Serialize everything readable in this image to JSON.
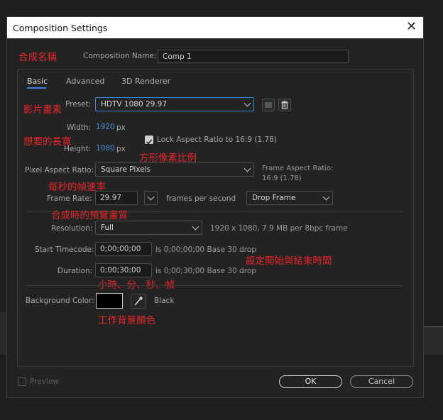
{
  "dialog": {
    "title": "Composition Settings",
    "close_glyph": "✕"
  },
  "comp_name": {
    "label": "Composition Name:",
    "value": "Comp 1"
  },
  "tabs": [
    {
      "label": "Basic"
    },
    {
      "label": "Advanced"
    },
    {
      "label": "3D Renderer"
    }
  ],
  "preset": {
    "label": "Preset:",
    "value": "HDTV 1080 29.97"
  },
  "width": {
    "label": "Width:",
    "value": "1920",
    "unit": "px"
  },
  "height": {
    "label": "Height:",
    "value": "1080",
    "unit": "px"
  },
  "lock_aspect": {
    "label": "Lock Aspect Ratio to 16:9 (1.78)",
    "checked": true
  },
  "pixel_aspect": {
    "label": "Pixel Aspect Ratio:",
    "value": "Square Pixels"
  },
  "frame_aspect": {
    "label": "Frame Aspect Ratio:",
    "value": "16:9 (1.78)"
  },
  "frame_rate": {
    "label": "Frame Rate:",
    "value": "29.97",
    "unit": "frames per second",
    "drop": "Drop Frame"
  },
  "resolution": {
    "label": "Resolution:",
    "value": "Full",
    "info": "1920 x 1080, 7.9 MB per 8bpc frame"
  },
  "start_timecode": {
    "label": "Start Timecode:",
    "value": "0;00;00;00",
    "info": "is 0;00;00;00  Base 30  drop"
  },
  "duration": {
    "label": "Duration:",
    "value": "0;00;30;00",
    "info": "is 0;00;30;00  Base 30  drop"
  },
  "background": {
    "label": "Background Color:",
    "name": "Black",
    "color": "#000000"
  },
  "preview": {
    "label": "Preview"
  },
  "buttons": {
    "ok": "OK",
    "cancel": "Cancel"
  },
  "annotations": {
    "comp_name": "合成名稱",
    "preset": "影片畫素",
    "size": "想要的長寬",
    "square_pixel": "方形像素比例",
    "frame_rate": "每秒的幀速率",
    "resolution": "合成時的預覽畫質",
    "timecode": "設定開始與結束時間",
    "duration": "小時、分、秒、幀",
    "bg_color": "工作背景顏色"
  },
  "colors": {
    "accent": "#3b86e0",
    "annotation": "#e8262b",
    "blue_value": "#4d8fdc"
  }
}
